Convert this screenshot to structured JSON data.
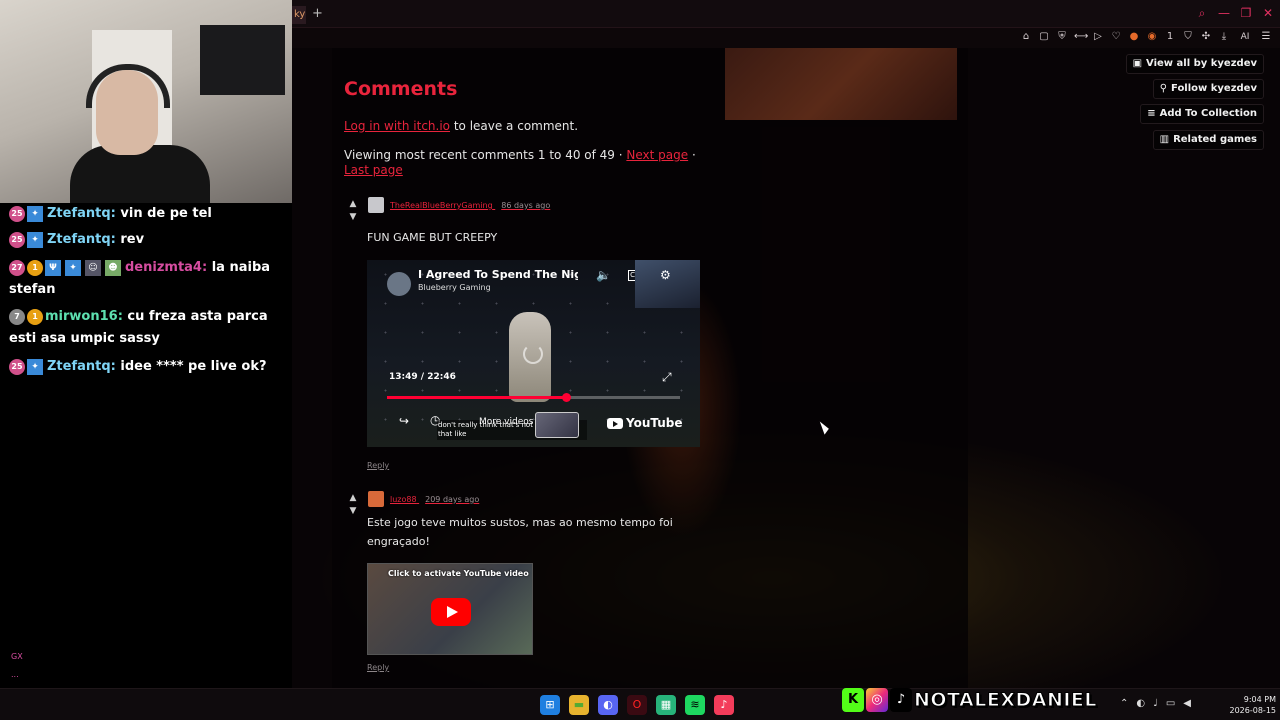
{
  "browser": {
    "tab_title": "kye",
    "new_tab": "+",
    "window_controls": [
      "search-icon",
      "minimize-icon",
      "maximize-icon",
      "close-icon"
    ],
    "extensions": [
      "bookmark-icon",
      "screenshot-icon",
      "shield-icon",
      "translate-icon",
      "play-icon",
      "heart-icon",
      "extension-icon",
      "extension-icon",
      "extension-icon",
      "extension-icon",
      "puzzle-icon",
      "download-icon"
    ],
    "ai_label": "AI",
    "badge_count": "1"
  },
  "comments": {
    "title": "Comments",
    "login_link": "Log in with itch.io",
    "login_suffix": " to leave a comment.",
    "viewing": "Viewing most recent comments 1 to 40 of 49 · ",
    "next_page": "Next page",
    "sep": " · ",
    "last_page": "Last page",
    "vote_up": "▲",
    "vote_down": "▼",
    "items": [
      {
        "author": "TheRealBlueBerryGaming",
        "ago": "86 days ago",
        "text": "FUN GAME BUT CREEPY",
        "reply": "Reply",
        "video": {
          "title": "I Agreed To Spend The Night A",
          "channel": "Blueberry Gaming",
          "cc": "CC",
          "time": "13:49 / 22:46",
          "progress": 0.61,
          "caption": "don't really think that's not mean, I do that like",
          "more_videos": "More videos",
          "youtube": "YouTube"
        }
      },
      {
        "author": "luzo88",
        "ago": "209 days ago",
        "text": "Este jogo teve muitos sustos, mas ao mesmo tempo foi engraçado!",
        "reply": "Reply",
        "video": {
          "activate": "Click to activate YouTube video"
        }
      }
    ]
  },
  "sidebar_buttons": [
    {
      "icon": "controller-icon",
      "label": "View all by kyezdev"
    },
    {
      "icon": "add-user-icon",
      "label": "Follow kyezdev"
    },
    {
      "icon": "playlist-add-icon",
      "label": "Add To Collection"
    },
    {
      "icon": "map-icon",
      "label": "Related games"
    }
  ],
  "chat": {
    "messages": [
      {
        "badge": "25",
        "user": "Ztefantq:",
        "text": " vin de pe tel"
      },
      {
        "badge": "25",
        "user": "Ztefantq:",
        "text": " rev"
      },
      {
        "badge": "27",
        "badge2": "1",
        "user": "denizmta4:",
        "text": " la naiba stefan"
      },
      {
        "badge": "7",
        "badge2": "1",
        "user": "mirwon16:",
        "text": " cu freza asta parca esti asa umpic sassy"
      },
      {
        "badge": "25",
        "user": "Ztefantq:",
        "text": " idee **** pe live ok?"
      }
    ],
    "footer1": "GX",
    "footer2": "..."
  },
  "taskbar": {
    "apps": [
      "windows-icon",
      "folder-icon",
      "discord-icon",
      "opera-icon",
      "app-icon",
      "spotify-icon",
      "tiktok-icon"
    ],
    "tray": [
      "chevron-up-icon",
      "discord-icon",
      "mic-icon",
      "wifi-icon",
      "volume-icon"
    ],
    "time": "9:04 PM",
    "date": "2026-08-15"
  },
  "social": {
    "kick": "K",
    "instagram": "◎",
    "tiktok": "♪",
    "name": "NOTALEXDANIEL"
  },
  "colors": {
    "accent": "#e8243c",
    "chat_blue": "#7fd4f5",
    "chat_pink": "#d64da0",
    "chat_green": "#5ee0b0"
  }
}
